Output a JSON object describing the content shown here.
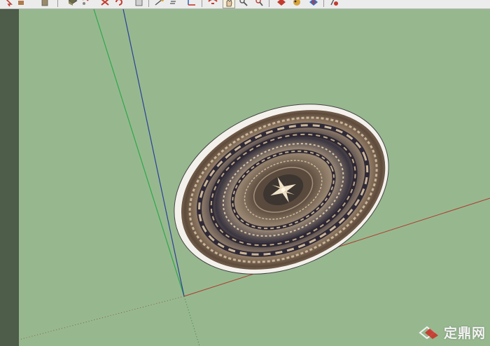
{
  "toolbar": {
    "buttons": [
      {
        "name": "select-tool-button",
        "icon": "arrow-icon",
        "color": "#c23a2f"
      },
      {
        "name": "eraser-tool-button",
        "icon": "eraser-icon",
        "color": "#b07a4a"
      },
      {
        "name": "make-component-button",
        "icon": "cube-icon",
        "color": "#6b7a4a"
      },
      {
        "name": "paint-bucket-button",
        "icon": "bucket-icon",
        "color": "#8a5a2a"
      },
      {
        "name": "push-pull-button",
        "icon": "pushpull-icon",
        "color": "#c23a2f"
      },
      {
        "name": "move-tool-button",
        "icon": "move-icon",
        "color": "#c23a2f"
      },
      {
        "name": "rotate-tool-button",
        "icon": "rotate-icon",
        "color": "#c23a2f"
      },
      {
        "name": "scale-tool-button",
        "icon": "scale-icon",
        "color": "#777777"
      },
      {
        "name": "tape-measure-button",
        "icon": "tape-icon",
        "color": "#d6a23a"
      },
      {
        "name": "text-tool-button",
        "icon": "text-icon",
        "color": "#555555"
      },
      {
        "name": "axes-tool-button",
        "icon": "axes-icon",
        "color": "#3a6ac2"
      },
      {
        "name": "orbit-tool-button",
        "icon": "orbit-icon",
        "color": "#c23a2f"
      },
      {
        "name": "pan-tool-button",
        "icon": "hand-icon",
        "color": "#e8c9a0"
      },
      {
        "name": "zoom-tool-button",
        "icon": "zoom-icon",
        "color": "#555555"
      },
      {
        "name": "zoom-extents-button",
        "icon": "zoom-extents-icon",
        "color": "#c23a2f"
      },
      {
        "name": "position-camera-button",
        "icon": "camera-icon",
        "color": "#c23a2f"
      },
      {
        "name": "walk-tool-button",
        "icon": "footprints-icon",
        "color": "#d6a23a"
      },
      {
        "name": "look-around-button",
        "icon": "eye-icon",
        "color": "#3a6ac2"
      },
      {
        "name": "section-plane-button",
        "icon": "section-icon",
        "color": "#c23a2f"
      }
    ]
  },
  "watermark": {
    "text": "定鼎网",
    "logo_icon": "diamond-logo-icon"
  },
  "scene": {
    "object": "ornamental-plate",
    "axis_colors": {
      "red": "#b03a2e",
      "green": "#2ea84a",
      "blue": "#2b3f96"
    },
    "background": "#97b88f"
  }
}
